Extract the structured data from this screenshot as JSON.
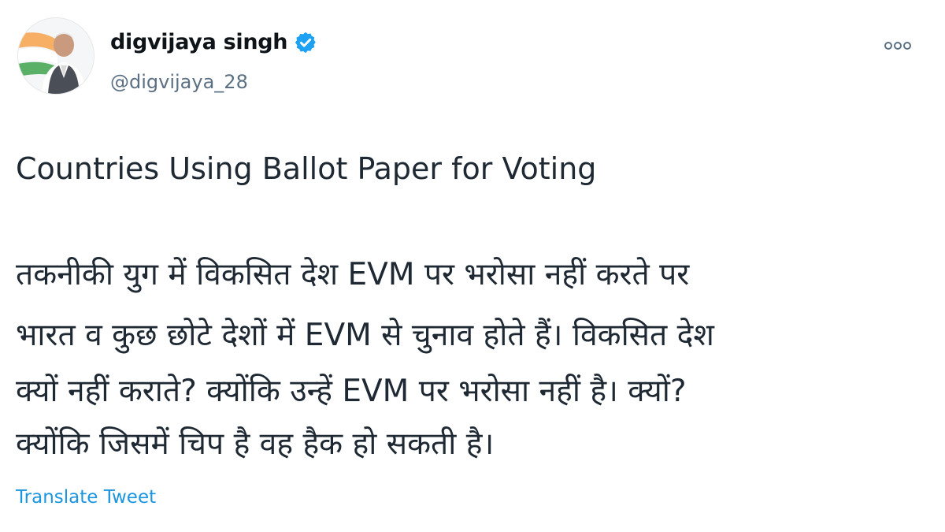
{
  "author": {
    "name": "digvijaya singh",
    "handle": "@digvijaya_28",
    "verified": true,
    "avatar_icon": "profile-photo"
  },
  "tweet": {
    "heading": "Countries Using Ballot Paper for Voting",
    "lines": [
      "तकनीकी युग में विकसित देश EVM पर भरोसा नहीं करते पर",
      "भारत व कुछ छोटे देशों में EVM से चुनाव होते हैं। विकसित देश",
      "क्यों नहीं कराते? क्योंकि उन्हें EVM पर भरोसा नहीं है। क्यों?",
      "क्योंकि जिसमें चिप है वह हैक हो सकती है।"
    ]
  },
  "actions": {
    "translate_label": "Translate Tweet",
    "more_icon": "more-options-icon"
  },
  "colors": {
    "link": "#1b95e0",
    "verified": "#1da1f2",
    "handle": "#5b7083",
    "text": "#0f1419"
  }
}
